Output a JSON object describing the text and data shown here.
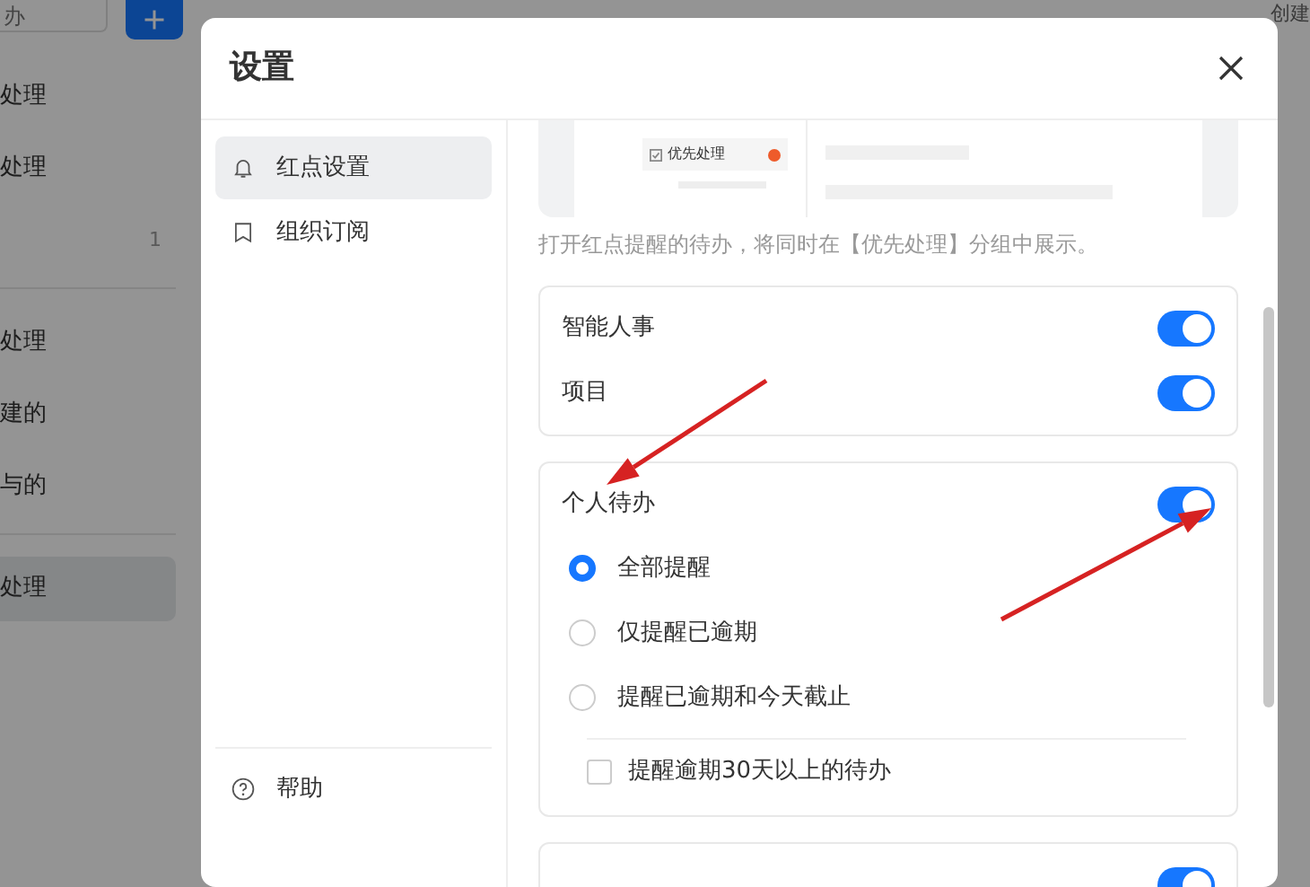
{
  "background_app": {
    "search": {
      "placeholder": "办"
    },
    "top_right": "创建",
    "groups": [
      [
        {
          "label": "处理",
          "selected": false
        },
        {
          "label": "处理",
          "selected": false
        },
        {
          "count": "1",
          "selected": false
        }
      ],
      [
        {
          "label": "处理",
          "selected": false
        },
        {
          "label": "建的",
          "selected": false
        },
        {
          "label": "与的",
          "selected": false
        }
      ],
      [
        {
          "label": "处理",
          "selected": true
        }
      ]
    ]
  },
  "dialog": {
    "title": "设置",
    "nav": [
      {
        "label": "红点设置",
        "selected": true
      },
      {
        "label": "组织订阅",
        "selected": false
      }
    ],
    "help": "帮助",
    "preview": {
      "item": "优先处理"
    },
    "caption": "打开红点提醒的待办，将同时在【优先处理】分组中展示。",
    "cards": [
      {
        "rows": [
          {
            "kind": "toggle",
            "label": "智能人事",
            "on": true
          },
          {
            "kind": "toggle",
            "label": "项目",
            "on": true
          }
        ]
      },
      {
        "rows": [
          {
            "kind": "toggle",
            "label": "个人待办",
            "on": true
          },
          {
            "kind": "radio",
            "label": "全部提醒",
            "selected": true
          },
          {
            "kind": "radio",
            "label": "仅提醒已逾期",
            "selected": false
          },
          {
            "kind": "radio",
            "label": "提醒已逾期和今天截止",
            "selected": false
          },
          {
            "kind": "checkbox",
            "label": "提醒逾期30天以上的待办",
            "checked": false
          }
        ]
      },
      {
        "rows": [
          {
            "kind": "toggle",
            "on": true
          }
        ]
      }
    ]
  },
  "annotations": [
    {
      "kind": "arrow"
    },
    {
      "kind": "arrow"
    }
  ]
}
